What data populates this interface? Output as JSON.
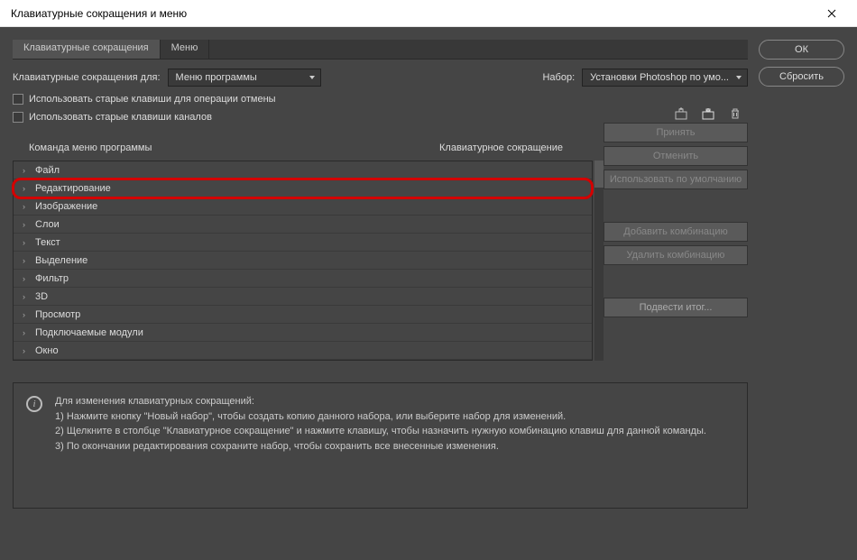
{
  "window": {
    "title": "Клавиатурные сокращения и меню"
  },
  "tabs": {
    "shortcuts": "Клавиатурные сокращения",
    "menus": "Меню"
  },
  "controls": {
    "shortcuts_for_label": "Клавиатурные сокращения для:",
    "shortcuts_for_value": "Меню программы",
    "set_label": "Набор:",
    "set_value": "Установки Photoshop по умо..."
  },
  "checkboxes": {
    "legacy_undo": "Использовать старые клавиши для операции отмены",
    "legacy_channels": "Использовать старые клавиши каналов"
  },
  "headers": {
    "command": "Команда меню программы",
    "shortcut": "Клавиатурное сокращение"
  },
  "tree": [
    {
      "label": "Файл"
    },
    {
      "label": "Редактирование",
      "highlighted": true
    },
    {
      "label": "Изображение"
    },
    {
      "label": "Слои"
    },
    {
      "label": "Текст"
    },
    {
      "label": "Выделение"
    },
    {
      "label": "Фильтр"
    },
    {
      "label": "3D"
    },
    {
      "label": "Просмотр"
    },
    {
      "label": "Подключаемые модули"
    },
    {
      "label": "Окно"
    }
  ],
  "side_buttons": {
    "ok": "ОК",
    "reset": "Сбросить"
  },
  "action_buttons": {
    "accept": "Принять",
    "undo": "Отменить",
    "use_default": "Использовать по умолчанию",
    "add_combo": "Добавить комбинацию",
    "del_combo": "Удалить комбинацию",
    "summarize": "Подвести итог..."
  },
  "help": {
    "title": "Для изменения клавиатурных сокращений:",
    "line1": "1) Нажмите кнопку \"Новый набор\", чтобы создать копию данного набора, или выберите набор для изменений.",
    "line2": "2) Щелкните в столбце \"Клавиатурное сокращение\" и нажмите клавишу, чтобы назначить нужную комбинацию клавиш для данной команды.",
    "line3": "3) По окончании редактирования сохраните набор, чтобы сохранить все внесенные изменения."
  }
}
